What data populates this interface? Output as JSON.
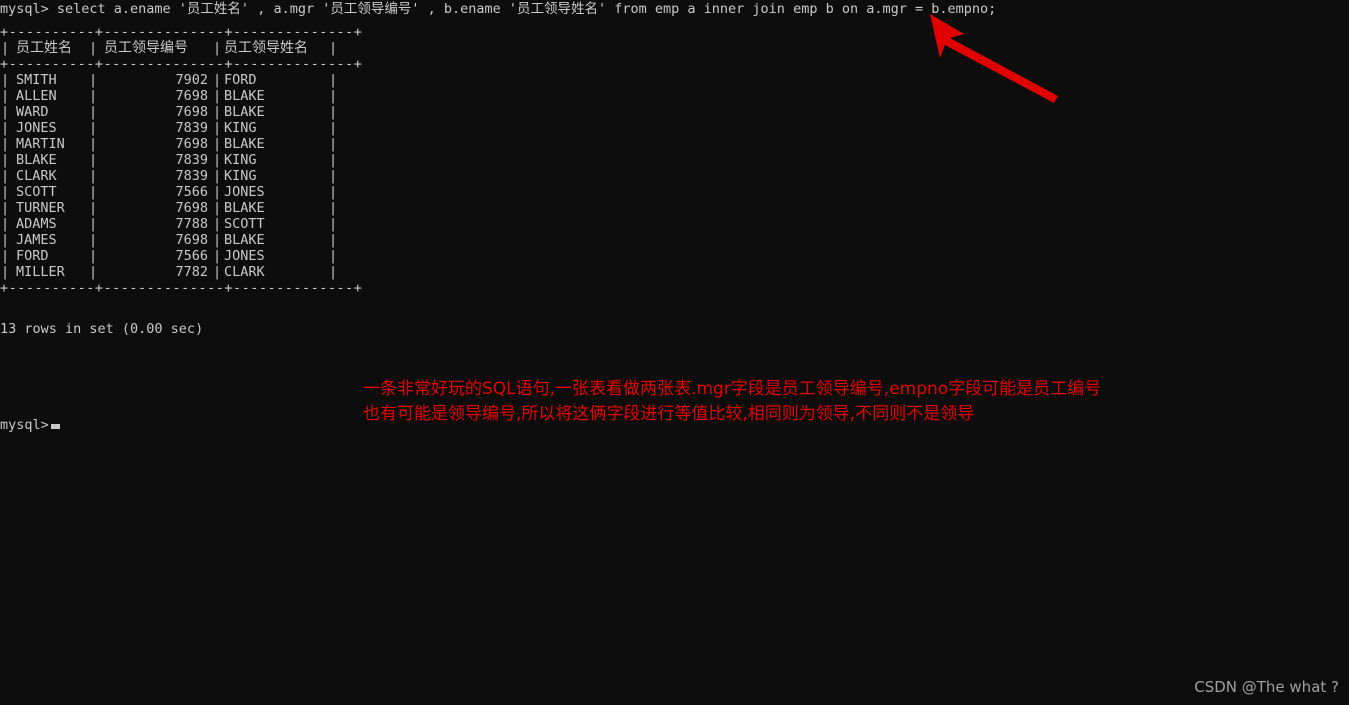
{
  "terminal": {
    "prompt": "mysql>",
    "query": "mysql> select a.ename '员工姓名' , a.mgr '员工领导编号' , b.ename '员工领导姓名' from emp a inner join emp b on a.mgr = b.empno;",
    "rule": "+----------+--------------+--------------+",
    "headers": [
      "员工姓名",
      "员工领导编号",
      "员工领导姓名"
    ],
    "rows": [
      {
        "name": "SMITH",
        "mgr": "7902",
        "leader": "FORD"
      },
      {
        "name": "ALLEN",
        "mgr": "7698",
        "leader": "BLAKE"
      },
      {
        "name": "WARD",
        "mgr": "7698",
        "leader": "BLAKE"
      },
      {
        "name": "JONES",
        "mgr": "7839",
        "leader": "KING"
      },
      {
        "name": "MARTIN",
        "mgr": "7698",
        "leader": "BLAKE"
      },
      {
        "name": "BLAKE",
        "mgr": "7839",
        "leader": "KING"
      },
      {
        "name": "CLARK",
        "mgr": "7839",
        "leader": "KING"
      },
      {
        "name": "SCOTT",
        "mgr": "7566",
        "leader": "JONES"
      },
      {
        "name": "TURNER",
        "mgr": "7698",
        "leader": "BLAKE"
      },
      {
        "name": "ADAMS",
        "mgr": "7788",
        "leader": "SCOTT"
      },
      {
        "name": "JAMES",
        "mgr": "7698",
        "leader": "BLAKE"
      },
      {
        "name": "FORD",
        "mgr": "7566",
        "leader": "JONES"
      },
      {
        "name": "MILLER",
        "mgr": "7782",
        "leader": "CLARK"
      }
    ],
    "result_status": "13 rows in set (0.00 sec)",
    "final_prompt": "mysql>",
    "text_color": "#c9c9c9",
    "background_color": "#0d0d0d"
  },
  "annotation": {
    "arrow_color": "#e00000",
    "note_color": "#e40000",
    "note_line1": "一条非常好玩的SQL语句,一张表看做两张表.mgr字段是员工领导编号,empno字段可能是员工编号",
    "note_line2": "也有可能是领导编号,所以将这俩字段进行等值比较,相同则为领导,不同则不是领导"
  },
  "watermark": {
    "text": "CSDN @The what ?"
  }
}
